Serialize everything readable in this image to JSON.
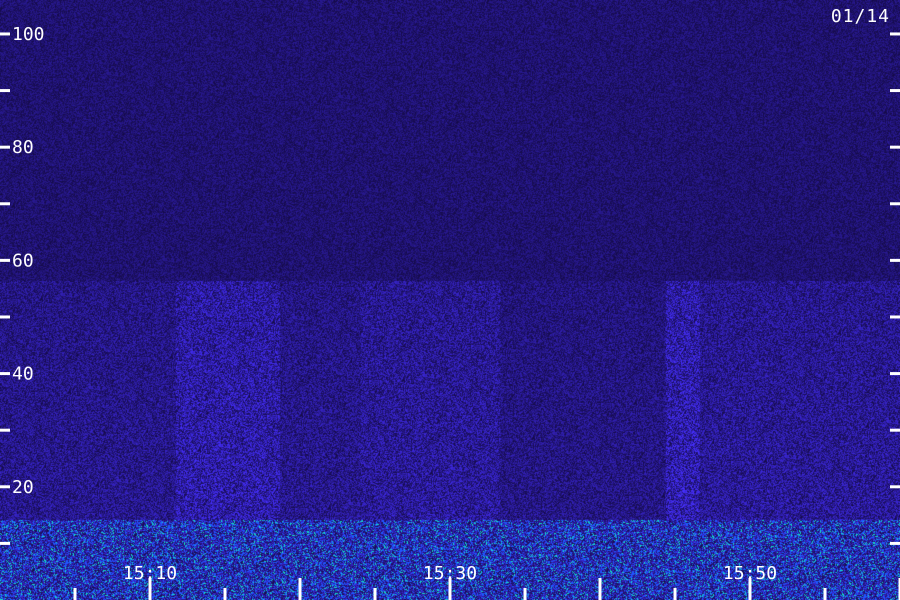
{
  "date_label": "01/14",
  "colors": {
    "background": "#1a0f5e",
    "signal": "#3a4cff",
    "strong_signal": "#00e0c0",
    "axis": "#ffffff"
  },
  "chart_data": {
    "type": "heatmap",
    "title": "",
    "xlabel": "",
    "ylabel": "",
    "ylim": [
      0,
      106
    ],
    "y_ticks": [
      100,
      90,
      80,
      70,
      60,
      50,
      40,
      30,
      20,
      10
    ],
    "y_tick_labels": [
      {
        "value": 100,
        "text": "100"
      },
      {
        "value": 80,
        "text": "80"
      },
      {
        "value": 60,
        "text": "60"
      },
      {
        "value": 40,
        "text": "40"
      },
      {
        "value": 20,
        "text": "20"
      }
    ],
    "x_tick_labels": [
      "15:10",
      "15:30",
      "15:50"
    ],
    "x_minor_ticks": 12
  }
}
